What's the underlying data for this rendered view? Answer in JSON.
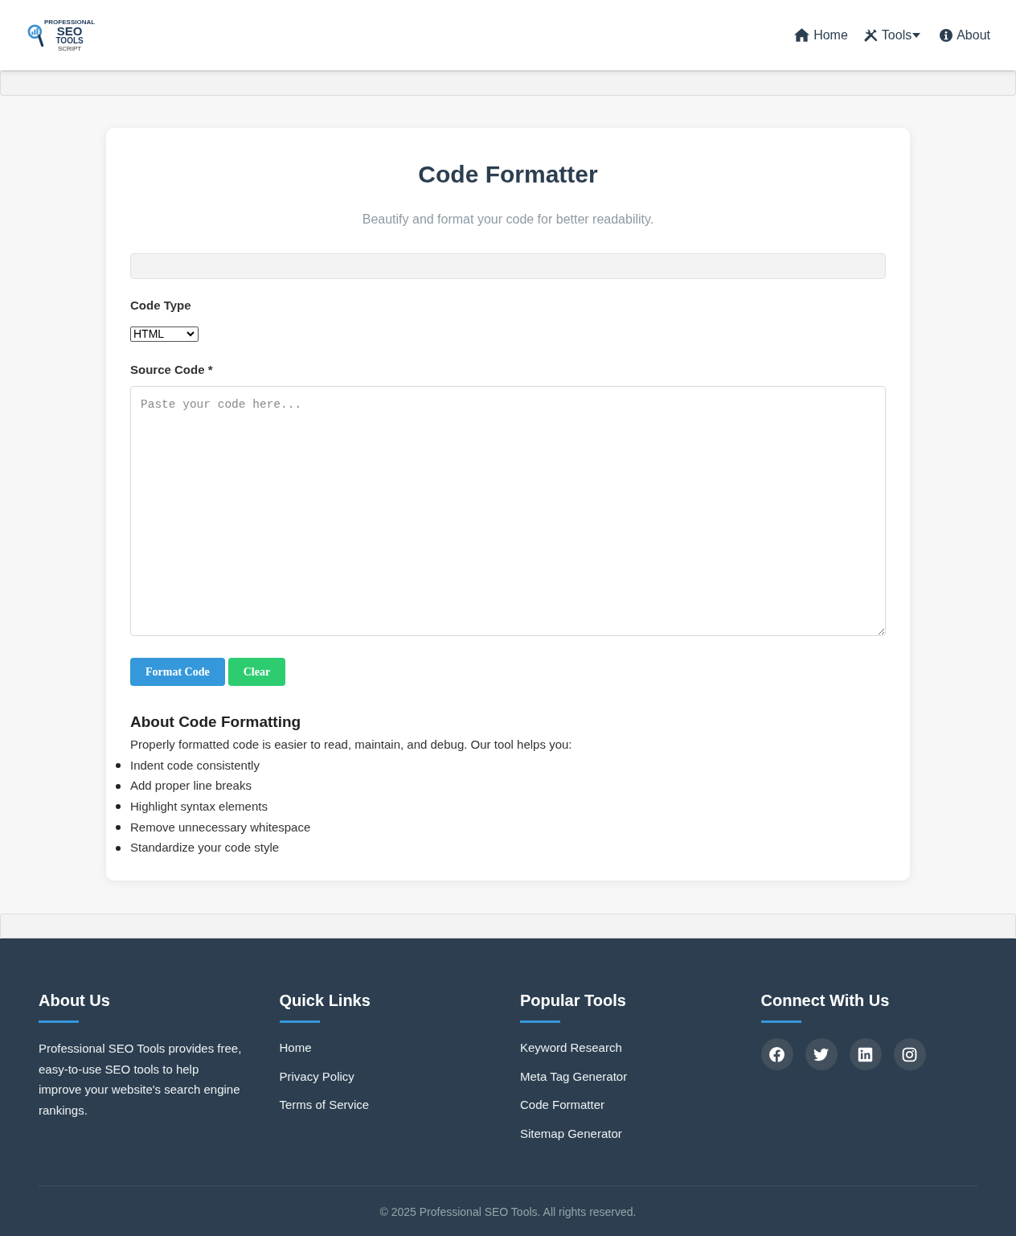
{
  "header": {
    "logo": {
      "lines": [
        "PROFESSIONAL",
        "SEO",
        "TOOLS",
        "SCRIPT"
      ]
    },
    "nav": [
      {
        "label": "Home",
        "dropdown": false
      },
      {
        "label": "Tools",
        "dropdown": true
      },
      {
        "label": "About",
        "dropdown": false
      }
    ]
  },
  "tool": {
    "title": "Code Formatter",
    "subtitle": "Beautify and format your code for better readability.",
    "code_type": {
      "label": "Code Type",
      "value": "HTML"
    },
    "source_code": {
      "label": "Source Code *",
      "placeholder": "Paste your code here..."
    },
    "buttons": [
      {
        "label": "Format Code",
        "kind": "primary"
      },
      {
        "label": "Clear",
        "kind": "success"
      }
    ],
    "about": {
      "heading": "About Code Formatting",
      "intro": "Properly formatted code is easier to read, maintain, and debug. Our tool helps you:",
      "items": [
        "Indent code consistently",
        "Add proper line breaks",
        "Highlight syntax elements",
        "Remove unnecessary whitespace",
        "Standardize your code style"
      ]
    }
  },
  "footer": {
    "columns": [
      {
        "kind": "text",
        "heading": "About Us",
        "text": "Professional SEO Tools provides free, easy-to-use SEO tools to help improve your website's search engine rankings."
      },
      {
        "kind": "links",
        "heading": "Quick Links",
        "links": [
          "Home",
          "Privacy Policy",
          "Terms of Service"
        ]
      },
      {
        "kind": "links",
        "heading": "Popular Tools",
        "links": [
          "Keyword Research",
          "Meta Tag Generator",
          "Code Formatter",
          "Sitemap Generator"
        ]
      },
      {
        "kind": "social",
        "heading": "Connect With Us"
      }
    ],
    "copyright": "© 2025 Professional SEO Tools. All rights reserved."
  }
}
